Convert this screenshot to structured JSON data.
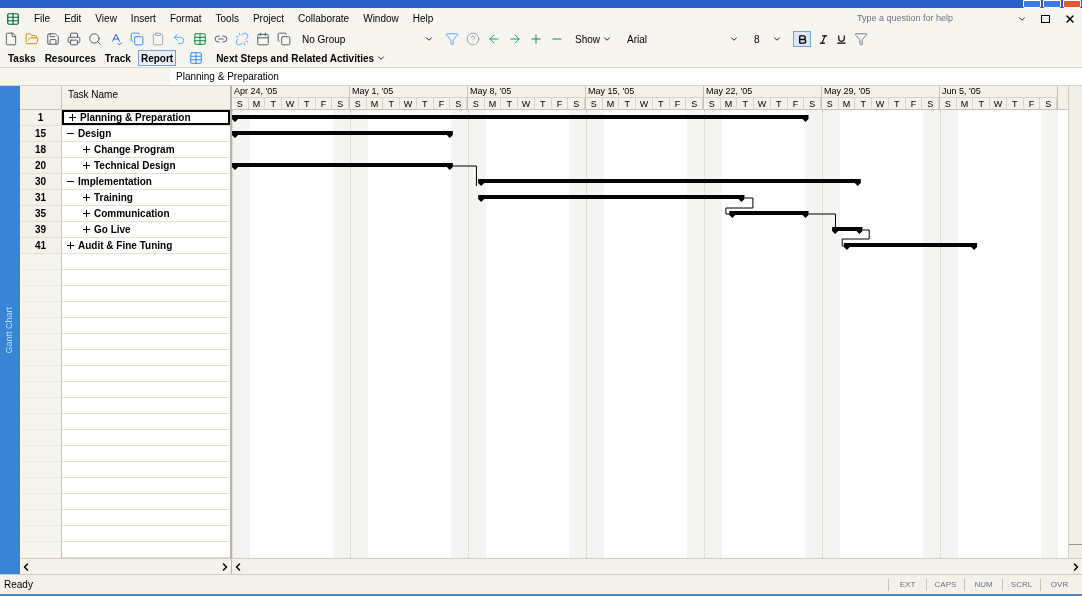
{
  "menu": [
    "File",
    "Edit",
    "View",
    "Insert",
    "Format",
    "Tools",
    "Project",
    "Collaborate",
    "Window",
    "Help"
  ],
  "help_box": {
    "placeholder": "Type a question for help"
  },
  "toolbar": {
    "group": "No Group",
    "show": "Show",
    "font": "Arial",
    "size": "8",
    "bold": true
  },
  "guide": {
    "tabs": [
      {
        "label": "Tasks",
        "selected": false
      },
      {
        "label": "Resources",
        "selected": false
      },
      {
        "label": "Track",
        "selected": false
      },
      {
        "label": "Report",
        "selected": true
      }
    ],
    "next_steps": "Next Steps and Related Activities"
  },
  "entry_bar": {
    "value": "Planning & Preparation"
  },
  "sidebar_label": "Gantt Chart",
  "table": {
    "column": "Task Name",
    "rows": [
      {
        "id": "1",
        "name": "Planning & Preparation",
        "expanded": false,
        "selected": true
      },
      {
        "id": "15",
        "name": "Design",
        "expanded": true,
        "selected": false,
        "children": [
          {
            "id": "18",
            "name": "Change Program",
            "expanded": false,
            "selected": false
          },
          {
            "id": "20",
            "name": "Technical Design",
            "expanded": false,
            "selected": false
          }
        ]
      },
      {
        "id": "30",
        "name": "Implementation",
        "expanded": true,
        "selected": false,
        "children": [
          {
            "id": "31",
            "name": "Training",
            "expanded": false,
            "selected": false
          },
          {
            "id": "35",
            "name": "Communication",
            "expanded": false,
            "selected": false
          },
          {
            "id": "39",
            "name": "Go Live",
            "expanded": false,
            "selected": false
          }
        ]
      },
      {
        "id": "41",
        "name": "Audit & Fine Tuning",
        "expanded": false,
        "selected": false
      }
    ]
  },
  "timeline": {
    "weeks": [
      {
        "label": "Apr 24, '05",
        "days": [
          "S",
          "M",
          "T",
          "W",
          "T",
          "F",
          "S"
        ]
      },
      {
        "label": "May 1, '05",
        "days": [
          "S",
          "M",
          "T",
          "W",
          "T",
          "F",
          "S"
        ]
      },
      {
        "label": "May 8, '05",
        "days": [
          "S",
          "M",
          "T",
          "W",
          "T",
          "F",
          "S"
        ]
      },
      {
        "label": "May 15, '05",
        "days": [
          "S",
          "M",
          "T",
          "W",
          "T",
          "F",
          "S"
        ]
      },
      {
        "label": "May 22, '05",
        "days": [
          "S",
          "M",
          "T",
          "W",
          "T",
          "F",
          "S"
        ]
      },
      {
        "label": "May 29, '05",
        "days": [
          "S",
          "M",
          "T",
          "W",
          "T",
          "F",
          "S"
        ]
      },
      {
        "label": "Jun 5, '05",
        "days": [
          "S",
          "M",
          "T",
          "W",
          "T",
          "F",
          "S"
        ]
      }
    ]
  },
  "status": {
    "text": "Ready",
    "indicators": [
      {
        "label": "EXT",
        "on": false
      },
      {
        "label": "CAPS",
        "on": false
      },
      {
        "label": "NUM",
        "on": false
      },
      {
        "label": "SCRL",
        "on": false
      },
      {
        "label": "OVR",
        "on": false
      }
    ]
  }
}
